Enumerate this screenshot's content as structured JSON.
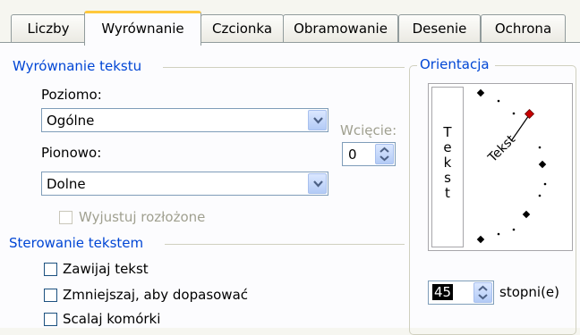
{
  "tabs": [
    {
      "label": "Liczby"
    },
    {
      "label": "Wyrównanie"
    },
    {
      "label": "Czcionka"
    },
    {
      "label": "Obramowanie"
    },
    {
      "label": "Desenie"
    },
    {
      "label": "Ochrona"
    }
  ],
  "active_tab": "Wyrównanie",
  "text_alignment": {
    "heading": "Wyrównanie tekstu",
    "horizontal_label": "Poziomo:",
    "horizontal_value": "Ogólne",
    "indent_label": "Wcięcie:",
    "indent_value": "0",
    "vertical_label": "Pionowo:",
    "vertical_value": "Dolne",
    "justify_distributed_label": "Wyjustuj rozłożone"
  },
  "text_control": {
    "heading": "Sterowanie tekstem",
    "wrap_label": "Zawijaj tekst",
    "shrink_label": "Zmniejszaj, aby dopasować",
    "merge_label": "Scalaj komórki",
    "wrap_checked": false,
    "shrink_checked": false,
    "merge_checked": false
  },
  "orientation": {
    "heading": "Orientacja",
    "vertical_text": "Tekst",
    "rotated_text": "Tekst",
    "degrees_value": "45",
    "degrees_label": "stopni(e)"
  },
  "colors": {
    "heading_blue": "#0046d5",
    "active_tab_accent": "#ffc83c",
    "dial_red": "#c80000"
  }
}
